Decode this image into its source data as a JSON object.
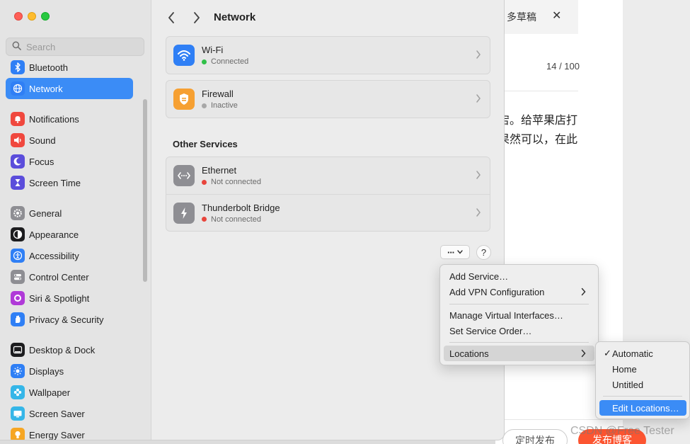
{
  "window": {
    "title": "Network",
    "search_placeholder": "Search"
  },
  "sidebar": {
    "items": [
      {
        "label": "Bluetooth",
        "icon": "bluetooth-icon",
        "color": "#2f7ff5"
      },
      {
        "label": "Network",
        "icon": "globe-icon",
        "color": "#2f7ff5",
        "active": true
      },
      {
        "label": "Notifications",
        "icon": "bell-icon",
        "color": "#f0483e"
      },
      {
        "label": "Sound",
        "icon": "speaker-icon",
        "color": "#f0483e"
      },
      {
        "label": "Focus",
        "icon": "moon-icon",
        "color": "#5b4ddb"
      },
      {
        "label": "Screen Time",
        "icon": "hourglass-icon",
        "color": "#5b4ddb"
      },
      {
        "label": "General",
        "icon": "gear-icon",
        "color": "#8e8e93"
      },
      {
        "label": "Appearance",
        "icon": "appearance-icon",
        "color": "#1c1c1e"
      },
      {
        "label": "Accessibility",
        "icon": "accessibility-icon",
        "color": "#2f7ff5"
      },
      {
        "label": "Control Center",
        "icon": "toggles-icon",
        "color": "#8e8e93"
      },
      {
        "label": "Siri & Spotlight",
        "icon": "siri-icon",
        "color": "#b03ad8"
      },
      {
        "label": "Privacy & Security",
        "icon": "hand-icon",
        "color": "#2f7ff5"
      },
      {
        "label": "Desktop & Dock",
        "icon": "dock-icon",
        "color": "#1c1c1e"
      },
      {
        "label": "Displays",
        "icon": "sun-icon",
        "color": "#2f7ff5"
      },
      {
        "label": "Wallpaper",
        "icon": "flower-icon",
        "color": "#35b6e8"
      },
      {
        "label": "Screen Saver",
        "icon": "screensaver-icon",
        "color": "#35b6e8"
      },
      {
        "label": "Energy Saver",
        "icon": "bulb-icon",
        "color": "#f6a623"
      }
    ]
  },
  "services": {
    "primary": [
      {
        "name": "Wi-Fi",
        "status": "Connected",
        "status_color": "#30c048",
        "icon": "wifi-icon",
        "icon_color": "#2f7ff5"
      },
      {
        "name": "Firewall",
        "status": "Inactive",
        "status_color": "#a8a8a8",
        "icon": "firewall-icon",
        "icon_color": "#f6a032"
      }
    ],
    "other_title": "Other Services",
    "other": [
      {
        "name": "Ethernet",
        "status": "Not connected",
        "status_color": "#e8453c",
        "icon": "ethernet-icon",
        "icon_color": "#8e8e93"
      },
      {
        "name": "Thunderbolt Bridge",
        "status": "Not connected",
        "status_color": "#e8453c",
        "icon": "thunderbolt-icon",
        "icon_color": "#8e8e93"
      }
    ]
  },
  "toolbar": {
    "more_label": "···",
    "help_label": "?"
  },
  "action_menu": {
    "items": [
      "Add Service…",
      "Add VPN Configuration",
      "Manage Virtual Interfaces…",
      "Set Service Order…",
      "Locations"
    ]
  },
  "locations_menu": {
    "items": [
      "Automatic",
      "Home",
      "Untitled",
      "Edit Locations…"
    ],
    "checked": "Automatic"
  },
  "background_app": {
    "draft_label": "多草稿",
    "close_label": "✕",
    "counter": "14 / 100",
    "text_line1": "宕。给苹果店打",
    "text_line2": "果然可以，在此",
    "timed_publish": "定时发布",
    "publish": "发布博客",
    "watermark": "CSDN @Free Tester"
  }
}
